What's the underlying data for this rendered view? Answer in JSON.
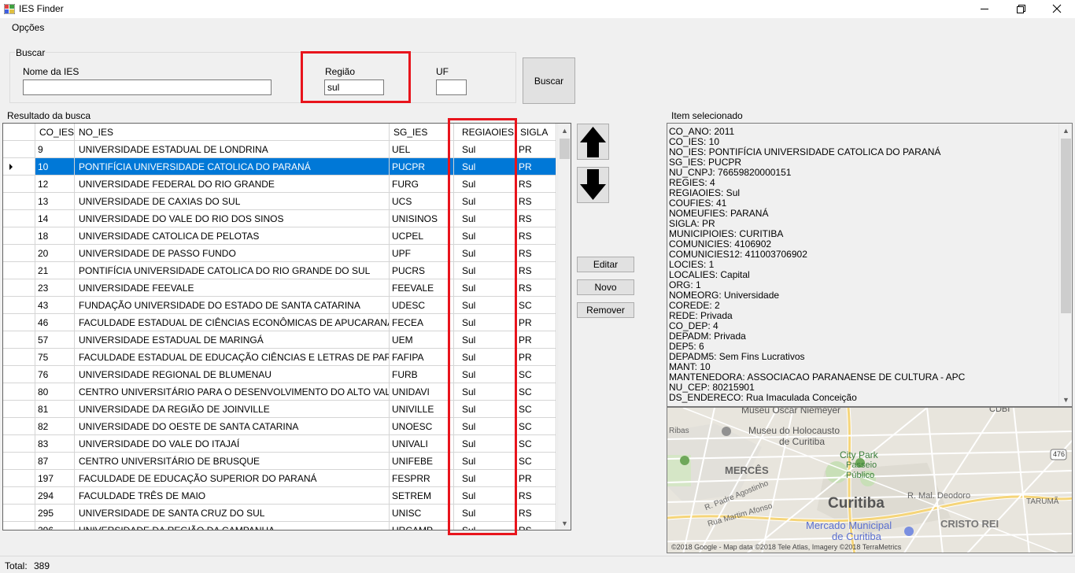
{
  "window": {
    "title": "IES Finder"
  },
  "menu": {
    "opcoes": "Opções"
  },
  "search": {
    "group_label": "Buscar",
    "nome_label": "Nome da IES",
    "nome_value": "",
    "regiao_label": "Região",
    "regiao_value": "sul",
    "uf_label": "UF",
    "uf_value": "",
    "button": "Buscar"
  },
  "results": {
    "label": "Resultado da busca",
    "columns": [
      "CO_IES",
      "NO_IES",
      "SG_IES",
      "REGIAOIES",
      "SIGLA"
    ],
    "selected_row": 1,
    "rows": [
      [
        "9",
        "UNIVERSIDADE ESTADUAL DE LONDRINA",
        "UEL",
        "Sul",
        "PR"
      ],
      [
        "10",
        "PONTIFÍCIA UNIVERSIDADE CATOLICA DO PARANÁ",
        "PUCPR",
        "Sul",
        "PR"
      ],
      [
        "12",
        "UNIVERSIDADE FEDERAL DO RIO GRANDE",
        "FURG",
        "Sul",
        "RS"
      ],
      [
        "13",
        "UNIVERSIDADE DE CAXIAS DO SUL",
        "UCS",
        "Sul",
        "RS"
      ],
      [
        "14",
        "UNIVERSIDADE DO VALE DO RIO DOS SINOS",
        "UNISINOS",
        "Sul",
        "RS"
      ],
      [
        "18",
        "UNIVERSIDADE CATOLICA DE PELOTAS",
        "UCPEL",
        "Sul",
        "RS"
      ],
      [
        "20",
        "UNIVERSIDADE DE PASSO FUNDO",
        "UPF",
        "Sul",
        "RS"
      ],
      [
        "21",
        "PONTIFÍCIA UNIVERSIDADE CATOLICA DO RIO GRANDE DO SUL",
        "PUCRS",
        "Sul",
        "RS"
      ],
      [
        "23",
        "UNIVERSIDADE FEEVALE",
        "FEEVALE",
        "Sul",
        "RS"
      ],
      [
        "43",
        "FUNDAÇÃO UNIVERSIDADE DO ESTADO DE SANTA CATARINA",
        "UDESC",
        "Sul",
        "SC"
      ],
      [
        "46",
        "FACULDADE ESTADUAL DE CIÊNCIAS ECONÔMICAS DE APUCARANA",
        "FECEA",
        "Sul",
        "PR"
      ],
      [
        "57",
        "UNIVERSIDADE ESTADUAL DE MARINGÁ",
        "UEM",
        "Sul",
        "PR"
      ],
      [
        "75",
        "FACULDADE ESTADUAL DE EDUCAÇÃO CIÊNCIAS E LETRAS DE PARANAV...",
        "FAFIPA",
        "Sul",
        "PR"
      ],
      [
        "76",
        "UNIVERSIDADE REGIONAL DE BLUMENAU",
        "FURB",
        "Sul",
        "SC"
      ],
      [
        "80",
        "CENTRO UNIVERSITÁRIO PARA O DESENVOLVIMENTO DO ALTO VALE D...",
        "UNIDAVI",
        "Sul",
        "SC"
      ],
      [
        "81",
        "UNIVERSIDADE DA REGIÃO DE JOINVILLE",
        "UNIVILLE",
        "Sul",
        "SC"
      ],
      [
        "82",
        "UNIVERSIDADE DO OESTE DE SANTA CATARINA",
        "UNOESC",
        "Sul",
        "SC"
      ],
      [
        "83",
        "UNIVERSIDADE DO VALE DO ITAJAÍ",
        "UNIVALI",
        "Sul",
        "SC"
      ],
      [
        "87",
        "CENTRO UNIVERSITÁRIO DE BRUSQUE",
        "UNIFEBE",
        "Sul",
        "SC"
      ],
      [
        "197",
        "FACULDADE DE EDUCAÇÃO SUPERIOR DO PARANÁ",
        "FESPRR",
        "Sul",
        "PR"
      ],
      [
        "294",
        "FACULDADE TRÊS DE MAIO",
        "SETREM",
        "Sul",
        "RS"
      ],
      [
        "295",
        "UNIVERSIDADE DE SANTA CRUZ DO SUL",
        "UNISC",
        "Sul",
        "RS"
      ],
      [
        "296",
        "UNIVERSIDADE DA REGIÃO DA CAMPANHA",
        "URCAMP",
        "Sul",
        "RS"
      ]
    ]
  },
  "actions": {
    "editar": "Editar",
    "novo": "Novo",
    "remover": "Remover"
  },
  "selected_item": {
    "label": "Item selecionado",
    "lines": [
      "CO_ANO: 2011",
      "CO_IES: 10",
      "NO_IES: PONTIFÍCIA UNIVERSIDADE CATOLICA DO PARANÁ",
      "SG_IES: PUCPR",
      "NU_CNPJ: 76659820000151",
      "REGIES: 4",
      "REGIAOIES: Sul",
      "COUFIES: 41",
      "NOMEUFIES: PARANÁ",
      "SIGLA: PR",
      "MUNICIPIOIES: CURITIBA",
      "COMUNICIES: 4106902",
      "COMUNICIES12: 411003706902",
      "LOCIES: 1",
      "LOCALIES: Capital",
      "ORG: 1",
      "NOMEORG: Universidade",
      "COREDE: 2",
      "REDE: Privada",
      "CO_DEP: 4",
      "DEPADM: Privada",
      "DEP5: 6",
      "DEPADM5: Sem Fins Lucrativos",
      "MANT: 10",
      "MANTENEDORA: ASSOCIACAO PARANAENSE DE CULTURA - APC",
      "NU_CEP: 80215901",
      "DS_ENDERECO: Rua Imaculada Conceição"
    ]
  },
  "map": {
    "labels": {
      "museu_oscar": "Museu Oscar Niemeyer",
      "museu_holocausto_1": "Museu do Holocausto",
      "museu_holocausto_2": "de Curitiba",
      "ribas": "Ribas",
      "city_park": "City Park",
      "passeio_1": "Passeio",
      "passeio_2": "Público",
      "merces": "MERCÊS",
      "curitiba": "Curitiba",
      "padre": "R. Padre Agostinho",
      "martim": "Rua Martim Afonso",
      "mal_deodoro": "R. Mal. Deodoro",
      "taruma": "TARUMÃ",
      "cristo_rei": "CRISTO REI",
      "mercado_1": "Mercado Municipal",
      "mercado_2": "de Curitiba",
      "route": "476",
      "cdbi": "CDBI"
    },
    "attribution": "©2018 Google - Map data ©2018 Tele Atlas, Imagery ©2018 TerraMetrics"
  },
  "status": {
    "total_label": "Total:",
    "total_value": "389"
  }
}
